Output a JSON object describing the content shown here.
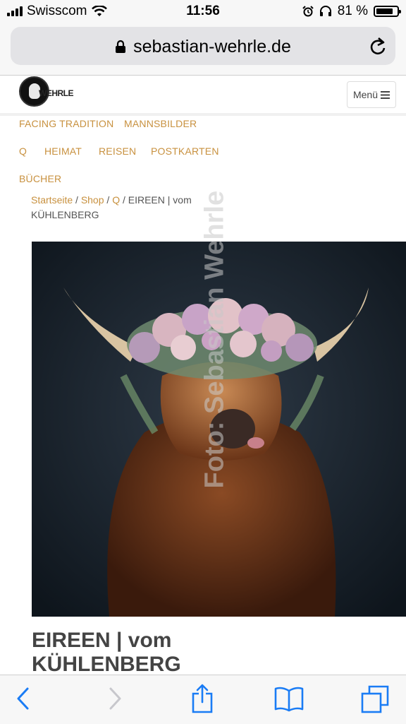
{
  "status": {
    "carrier": "Swisscom",
    "time": "11:56",
    "battery": "81 %",
    "battery_level": 0.81
  },
  "browser": {
    "url": "sebastian-wehrle.de"
  },
  "site": {
    "logo_text": "WEHRLE",
    "menu_label": "Menü"
  },
  "nav": {
    "items": [
      "FACING TRADITION",
      "MANNSBILDER",
      "Q",
      "HEIMAT",
      "REISEN",
      "POSTKARTEN",
      "BÜCHER"
    ]
  },
  "breadcrumb": {
    "home": "Startseite",
    "shop": "Shop",
    "category": "Q",
    "current": "EIREEN | vom KÜHLENBERG",
    "separator": "/"
  },
  "product": {
    "image_watermark": "Foto: Sebastian Wehrle",
    "title_line1": "EIREEN | vom",
    "title_line2": "KÜHLENBERG"
  },
  "icons": {
    "back": "back-chevron-icon",
    "forward": "forward-chevron-icon",
    "share": "share-icon",
    "bookmarks": "bookmarks-icon",
    "tabs": "tabs-icon"
  }
}
